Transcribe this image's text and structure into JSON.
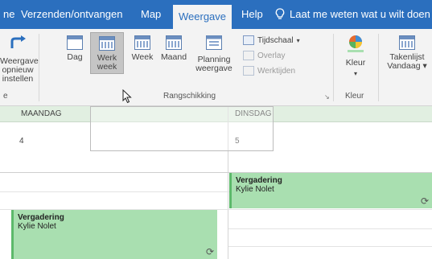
{
  "tabs": [
    {
      "label": "ne",
      "active": false
    },
    {
      "label": "Verzenden/ontvangen",
      "active": false
    },
    {
      "label": "Map",
      "active": false
    },
    {
      "label": "Weergave",
      "active": true
    },
    {
      "label": "Help",
      "active": false
    }
  ],
  "tell_me": "Laat me weten wat u wilt doen",
  "ribbon": {
    "reset_view": {
      "line1": "Weergave",
      "line2": "opnieuw",
      "line3": "instellen"
    },
    "day": "Dag",
    "work_week": {
      "line1": "Werk",
      "line2": "week"
    },
    "week": "Week",
    "month": "Maand",
    "planning": {
      "line1": "Planning",
      "line2": "weergave"
    },
    "timescale": "Tijdschaal",
    "overlay": "Overlay",
    "working_hours": "Werktijden",
    "arrangement_label": "Rangschikking",
    "color": "Kleur",
    "color_group_label": "Kleur",
    "tasklist": {
      "line1": "Takenlijst",
      "line2": "Vandaag"
    },
    "edge_e": "e"
  },
  "calendar": {
    "days": [
      {
        "name": "MAANDAG",
        "date": "4"
      },
      {
        "name": "DINSDAG",
        "date": "5"
      }
    ],
    "events": [
      {
        "title": "Vergadering",
        "organizer": "Kylie Nolet"
      },
      {
        "title": "Vergadering",
        "organizer": "Kylie Nolet"
      }
    ]
  },
  "colors": {
    "titlebar": "#2b6fbe",
    "ribbon_bg": "#f3f3f3",
    "event_fill": "#a9dfb0",
    "event_border": "#5db96b",
    "day_header": "#e1efe1"
  }
}
